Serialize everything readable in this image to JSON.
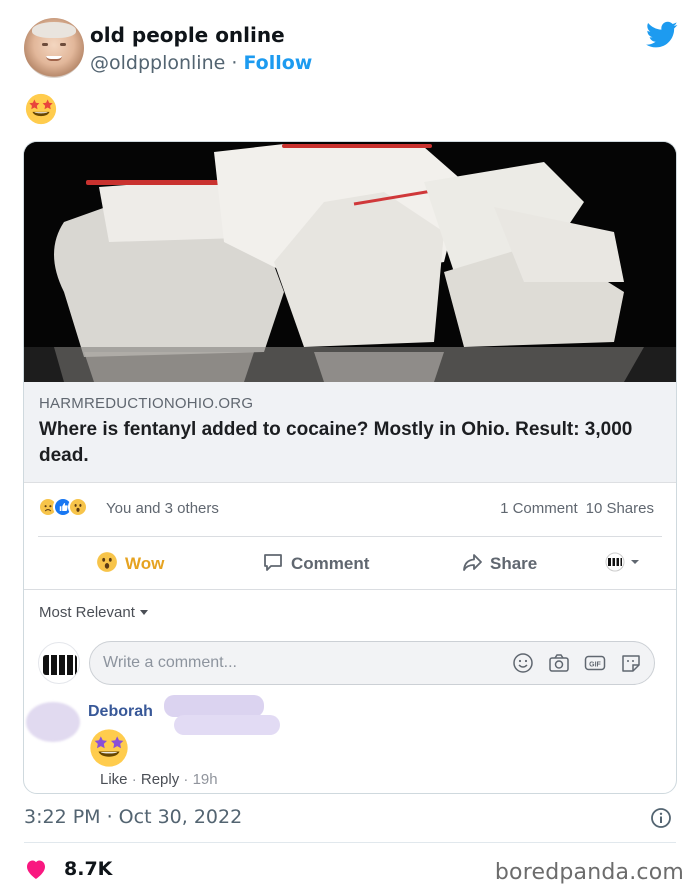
{
  "tweet": {
    "author_name": "old people online",
    "handle": "@oldpplonline",
    "separator": "·",
    "follow_label": "Follow",
    "emoji": "star-struck-emoji",
    "timestamp": "3:22 PM · Oct 30, 2022",
    "like_count": "8.7K",
    "accent_color": "#1d9bf0",
    "like_color": "#f91880"
  },
  "facebook_post": {
    "link_domain": "HARMREDUCTIONOHIO.ORG",
    "link_headline": "Where is fentanyl added to cocaine? Mostly in Ohio. Result: 3,000 dead.",
    "reactions_text": "You and 3 others",
    "reaction_icons": [
      "sad-reaction-icon",
      "like-reaction-icon",
      "wow-reaction-icon"
    ],
    "comment_count": "1 Comment",
    "share_count": "10 Shares",
    "actions": {
      "wow_label": "Wow",
      "comment_label": "Comment",
      "share_label": "Share"
    },
    "sort_label": "Most Relevant",
    "comment_input_placeholder": "Write a comment...",
    "comment": {
      "author": "Deborah",
      "like_label": "Like",
      "reply_label": "Reply",
      "dot": "·",
      "age": "19h"
    }
  },
  "watermark": "boredpanda.com"
}
